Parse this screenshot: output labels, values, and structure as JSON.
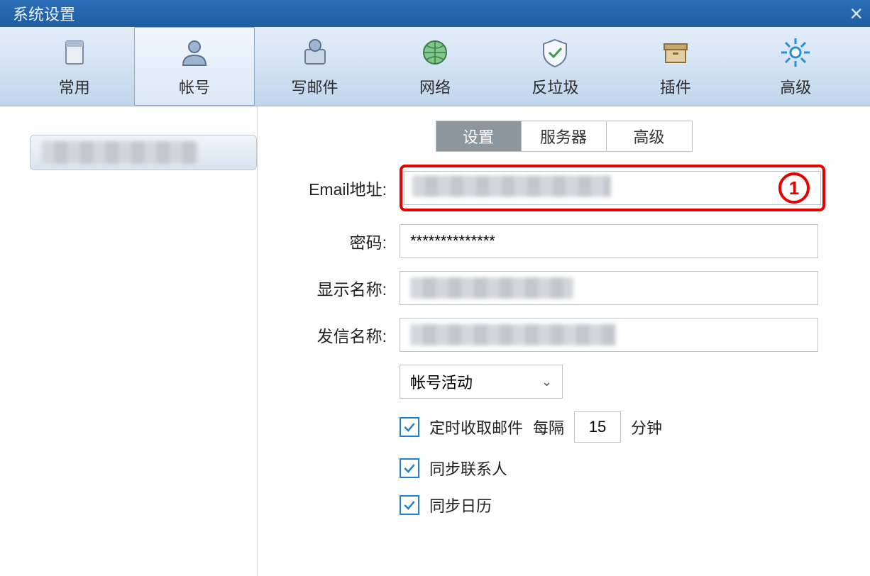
{
  "window": {
    "title": "系统设置"
  },
  "toolbar": {
    "items": [
      {
        "id": "general",
        "label": "常用"
      },
      {
        "id": "account",
        "label": "帐号"
      },
      {
        "id": "compose",
        "label": "写邮件"
      },
      {
        "id": "network",
        "label": "网络"
      },
      {
        "id": "antispam",
        "label": "反垃圾"
      },
      {
        "id": "plugins",
        "label": "插件"
      },
      {
        "id": "advanced",
        "label": "高级"
      }
    ],
    "active": "account"
  },
  "tabs": {
    "items": [
      {
        "id": "settings",
        "label": "设置"
      },
      {
        "id": "server",
        "label": "服务器"
      },
      {
        "id": "advanced",
        "label": "高级"
      }
    ],
    "active": "settings"
  },
  "form": {
    "email_label": "Email地址:",
    "email_value": "",
    "password_label": "密码:",
    "password_value": "**************",
    "display_name_label": "显示名称:",
    "display_name_value": "",
    "sender_name_label": "发信名称:",
    "sender_name_value": "",
    "status_select": "帐号活动",
    "fetch_scheduled_label": "定时收取邮件",
    "fetch_interval_prefix": "每隔",
    "fetch_interval_value": "15",
    "fetch_interval_suffix": "分钟",
    "sync_contacts_label": "同步联系人",
    "sync_calendar_label": "同步日历",
    "fetch_checked": true,
    "sync_contacts_checked": true,
    "sync_calendar_checked": true
  },
  "annotation": {
    "marker": "1"
  }
}
